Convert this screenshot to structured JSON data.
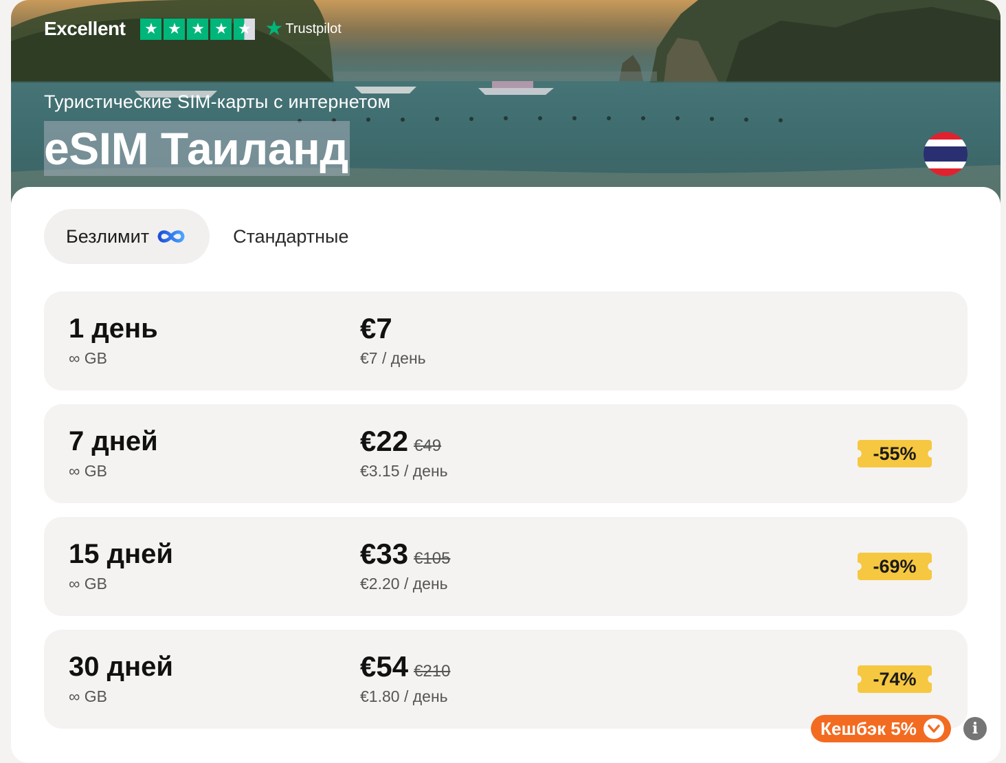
{
  "trustpilot": {
    "rating_label": "Excellent",
    "stars": 4.5,
    "brand": "Trustpilot",
    "star_glyph": "★",
    "brand_color": "#00b67a"
  },
  "hero": {
    "subtitle": "Туристические SIM-карты с интернетом",
    "title": "eSIM Таиланд",
    "flag_icon": "thailand-flag-icon"
  },
  "tabs": [
    {
      "label": "Безлимит",
      "icon": "infinity-icon",
      "active": true
    },
    {
      "label": "Стандартные",
      "active": false
    }
  ],
  "plans": [
    {
      "days": "1 день",
      "data": "∞ GB",
      "price": "€7",
      "old_price": "",
      "per_day": "€7 / день",
      "discount": ""
    },
    {
      "days": "7 дней",
      "data": "∞ GB",
      "price": "€22",
      "old_price": "€49",
      "per_day": "€3.15 / день",
      "discount": "-55%"
    },
    {
      "days": "15 дней",
      "data": "∞ GB",
      "price": "€33",
      "old_price": "€105",
      "per_day": "€2.20 / день",
      "discount": "-69%"
    },
    {
      "days": "30 дней",
      "data": "∞ GB",
      "price": "€54",
      "old_price": "€210",
      "per_day": "€1.80 / день",
      "discount": "-74%"
    }
  ],
  "cashback": {
    "label": "Кешбэк 5%",
    "icon": "chevron-down-icon",
    "color": "#f36b21"
  },
  "info_button": {
    "label": "i",
    "icon": "info-icon"
  },
  "colors": {
    "badge": "#f6c740",
    "plan_bg": "#f4f3f1",
    "accent_blue": "#2f6fe0"
  }
}
